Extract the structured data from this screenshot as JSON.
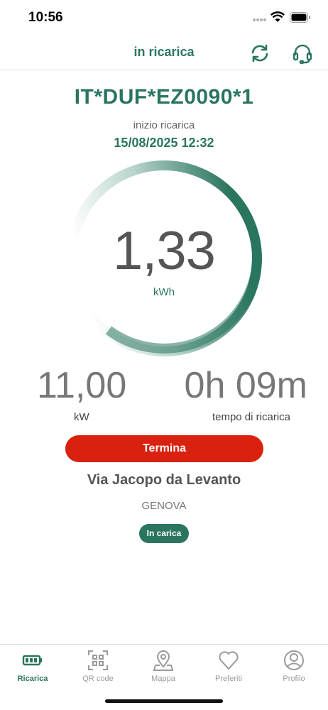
{
  "status_bar": {
    "time": "10:56"
  },
  "header": {
    "title": "in ricarica"
  },
  "session": {
    "station_id": "IT*DUF*EZ0090*1",
    "start_label": "inizio ricarica",
    "start_datetime": "15/08/2025 12:32",
    "energy_value": "1,33",
    "energy_unit": "kWh",
    "power_value": "11,00",
    "power_unit": "kW",
    "duration_value": "0h 09m",
    "duration_label": "tempo di ricarica",
    "stop_label": "Termina"
  },
  "location": {
    "street": "Via Jacopo da Levanto",
    "city": "GENOVA",
    "status_badge": "In carica"
  },
  "colors": {
    "accent": "#2a7560",
    "stop": "#d8220f"
  },
  "tabs": [
    {
      "label": "Ricarica",
      "icon": "battery-icon",
      "active": true
    },
    {
      "label": "QR code",
      "icon": "qr-code-icon",
      "active": false
    },
    {
      "label": "Mappa",
      "icon": "map-pin-icon",
      "active": false
    },
    {
      "label": "Preferiti",
      "icon": "heart-icon",
      "active": false
    },
    {
      "label": "Profilo",
      "icon": "profile-icon",
      "active": false
    }
  ]
}
